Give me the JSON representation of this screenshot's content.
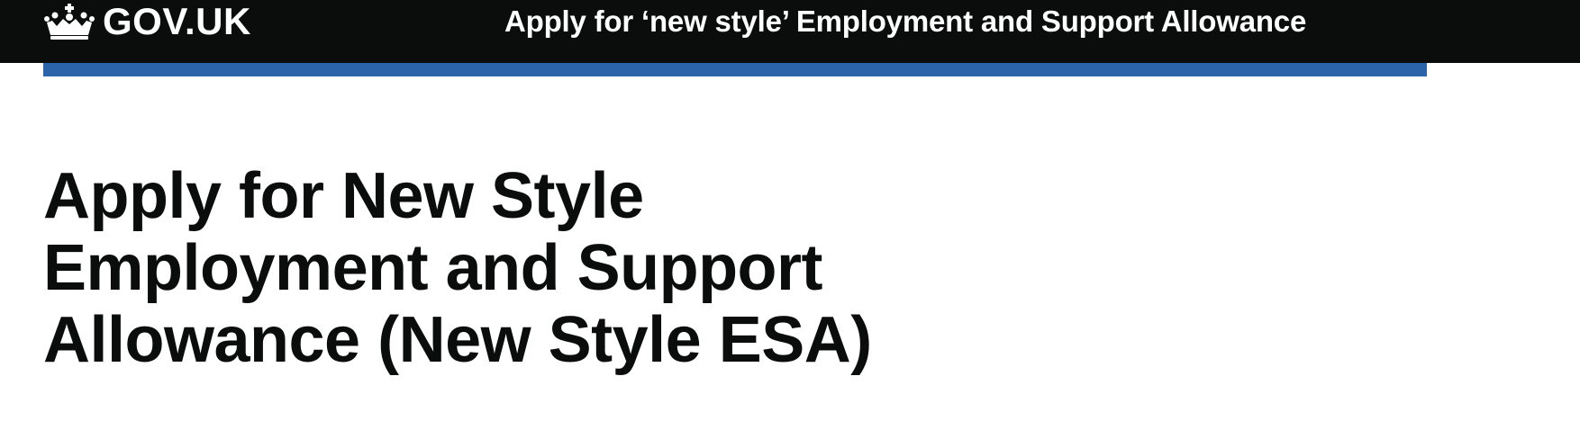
{
  "header": {
    "logo_text": "GOV.UK",
    "logo_icon": "crown-icon",
    "service_name": "Apply for ‘new style’ Employment and Support Allowance",
    "background_color": "#0b0c0c",
    "bar_color": "#2b64a9"
  },
  "main": {
    "title": "Apply for New Style Employment and Support Allowance (New Style ESA)"
  }
}
